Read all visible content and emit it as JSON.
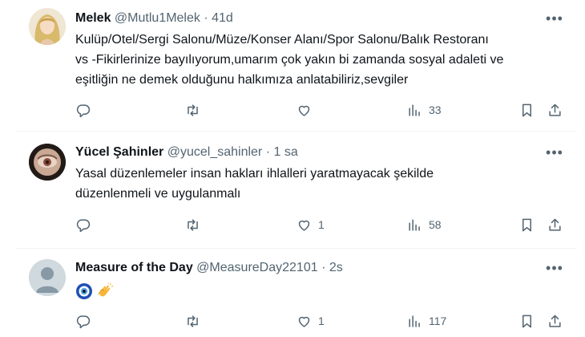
{
  "tweets": [
    {
      "name": "Melek",
      "handle": "@Mutlu1Melek",
      "separator": "·",
      "time": "41d",
      "more_label": "•••",
      "lines": [
        "Kulüp/Otel/Sergi Salonu/Müze/Konser Alanı/Spor Salonu/Balık Restoranı",
        "vs -Fikirlerinize bayılıyorum,umarım çok yakın bi zamanda sosyal adaleti ve",
        "eşitliğin ne demek olduğunu halkımıza anlatabiliriz,sevgiler"
      ],
      "likes": "",
      "views": "33"
    },
    {
      "name": "Yücel Şahinler",
      "handle": "@yucel_sahinler",
      "separator": "·",
      "time": "1 sa",
      "more_label": "•••",
      "lines": [
        "Yasal düzenlemeler insan hakları ihlalleri yaratmayacak şekilde",
        "düzenlenmeli ve uygulanmalı"
      ],
      "likes": "1",
      "views": "58"
    },
    {
      "name": "Measure of the Day",
      "handle": "@MeasureDay22101",
      "separator": "·",
      "time": "2s",
      "more_label": "•••",
      "emojis": [
        "nazar-amulet",
        "clapping-hands"
      ],
      "likes": "1",
      "views": "117"
    }
  ],
  "icons": {
    "reply": "reply-icon",
    "retweet": "retweet-icon",
    "like": "heart-icon",
    "views": "views-chart-icon",
    "bookmark": "bookmark-icon",
    "share": "share-icon"
  },
  "colors": {
    "text": "#0f1419",
    "secondary": "#536471",
    "divider": "#eff3f4"
  }
}
